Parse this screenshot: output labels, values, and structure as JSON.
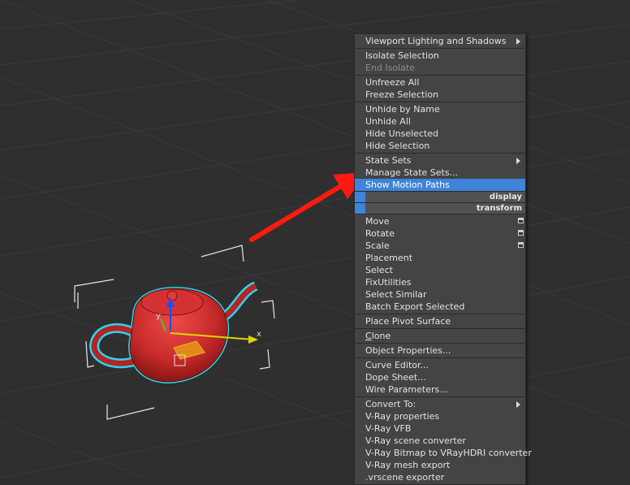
{
  "viewport": {
    "axis_labels": {
      "x": "x",
      "y": "y"
    },
    "colors": {
      "background": "#2f2f2f",
      "object": "#c72a2a",
      "selection_outline": "#25d8f0",
      "annotation_arrow": "#ff1a10"
    }
  },
  "quadmenu": {
    "sections": [
      [
        {
          "label": "Viewport Lighting and Shadows",
          "submenu": true
        }
      ],
      [
        {
          "label": "Isolate Selection"
        },
        {
          "label": "End Isolate",
          "disabled": true
        }
      ],
      [
        {
          "label": "Unfreeze All"
        },
        {
          "label": "Freeze Selection"
        }
      ],
      [
        {
          "label": "Unhide by Name"
        },
        {
          "label": "Unhide All"
        },
        {
          "label": "Hide Unselected"
        },
        {
          "label": "Hide Selection"
        }
      ],
      [
        {
          "label": "State Sets",
          "submenu": true
        },
        {
          "label": "Manage State Sets..."
        },
        {
          "label": "Show Motion Paths",
          "highlighted": true
        }
      ]
    ],
    "headers": {
      "display": "display",
      "transform": "transform"
    },
    "transform_items": [
      {
        "label": "Move",
        "options": true
      },
      {
        "label": "Rotate",
        "options": true
      },
      {
        "label": "Scale",
        "options": true
      },
      {
        "label": "Placement"
      },
      {
        "label": "Select"
      },
      {
        "label": "FixUtilities"
      },
      {
        "label": "Select Similar"
      },
      {
        "label": "Batch Export Selected"
      }
    ],
    "place_pivot": "Place Pivot Surface",
    "clone": {
      "first": "C",
      "rest": "lone"
    },
    "object_properties": "Object Properties...",
    "editors": [
      {
        "label": "Curve Editor..."
      },
      {
        "label": "Dope Sheet..."
      },
      {
        "label": "Wire Parameters..."
      }
    ],
    "convert": [
      {
        "label": "Convert To:",
        "submenu": true
      },
      {
        "label": "V-Ray properties"
      },
      {
        "label": "V-Ray VFB"
      },
      {
        "label": "V-Ray scene converter"
      },
      {
        "label": "V-Ray Bitmap to VRayHDRI converter"
      },
      {
        "label": "V-Ray mesh export"
      },
      {
        "label": ".vrscene exporter"
      }
    ]
  }
}
